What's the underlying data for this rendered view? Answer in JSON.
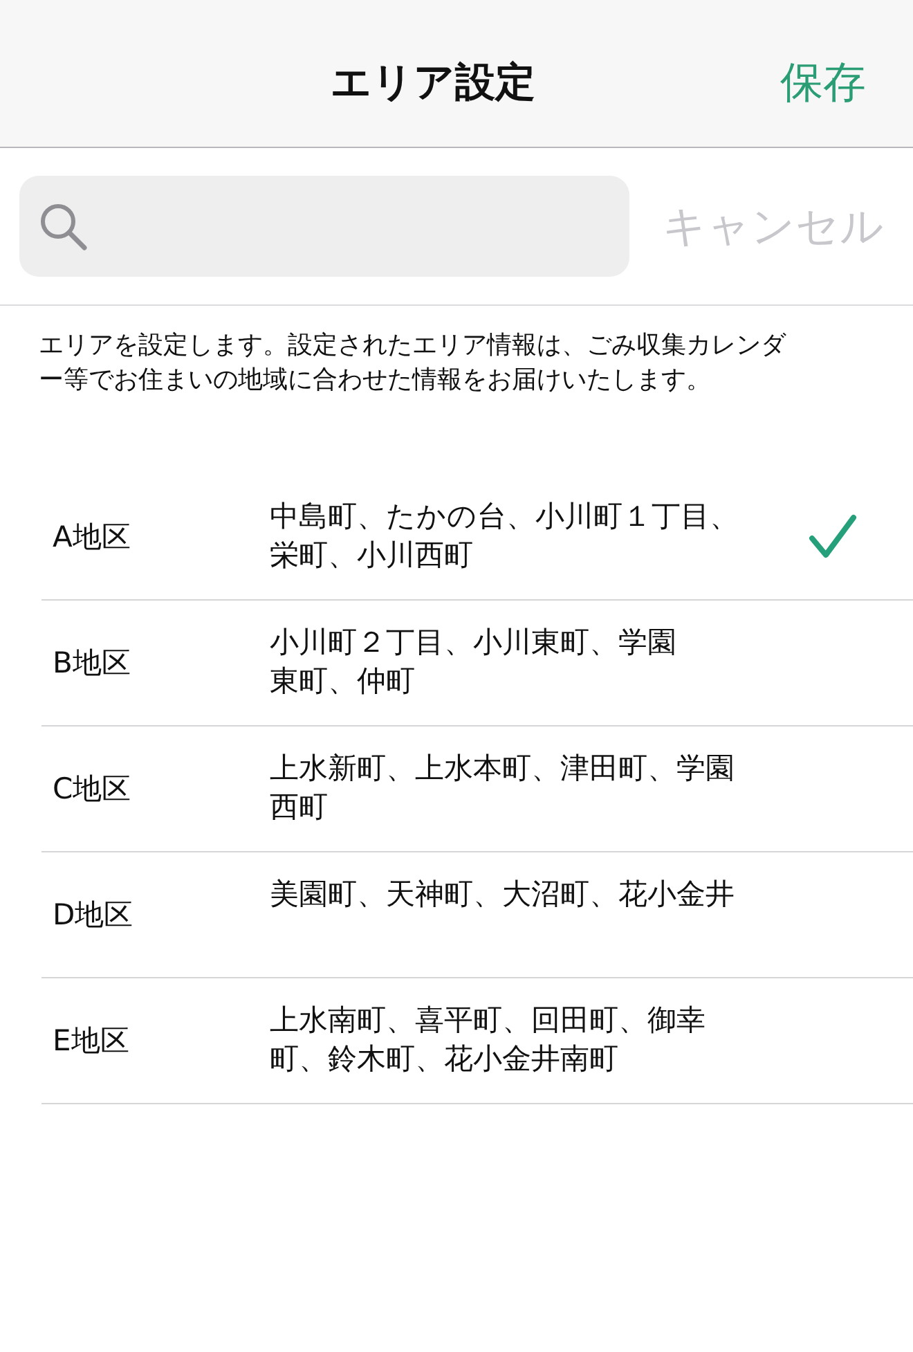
{
  "nav_bar": {
    "title": "エリア設定",
    "save": "保存"
  },
  "search": {
    "cancel": "キャンセル"
  },
  "description": {
    "lines": [
      "エリアを設定します。設定されたエリア情報は、ごみ収集カレンダ",
      "ー等でお住まいの地域に合わせた情報をお届けいたします。"
    ]
  },
  "areas": [
    {
      "label": "A地区",
      "towns": [
        "中島町、たかの台、小川町１丁目、",
        "栄町、小川西町"
      ],
      "selected": true
    },
    {
      "label": "B地区",
      "towns": [
        "小川町２丁目、小川東町、学園",
        "東町、仲町"
      ],
      "selected": false
    },
    {
      "label": "C地区",
      "towns": [
        "上水新町、上水本町、津田町、学園",
        "西町"
      ],
      "selected": false
    },
    {
      "label": "D地区",
      "towns": [
        "美園町、天神町、大沼町、花小金井"
      ],
      "selected": false
    },
    {
      "label": "E地区",
      "towns": [
        "上水南町、喜平町、回田町、御幸",
        "町、鈴木町、花小金井南町"
      ],
      "selected": false
    }
  ]
}
